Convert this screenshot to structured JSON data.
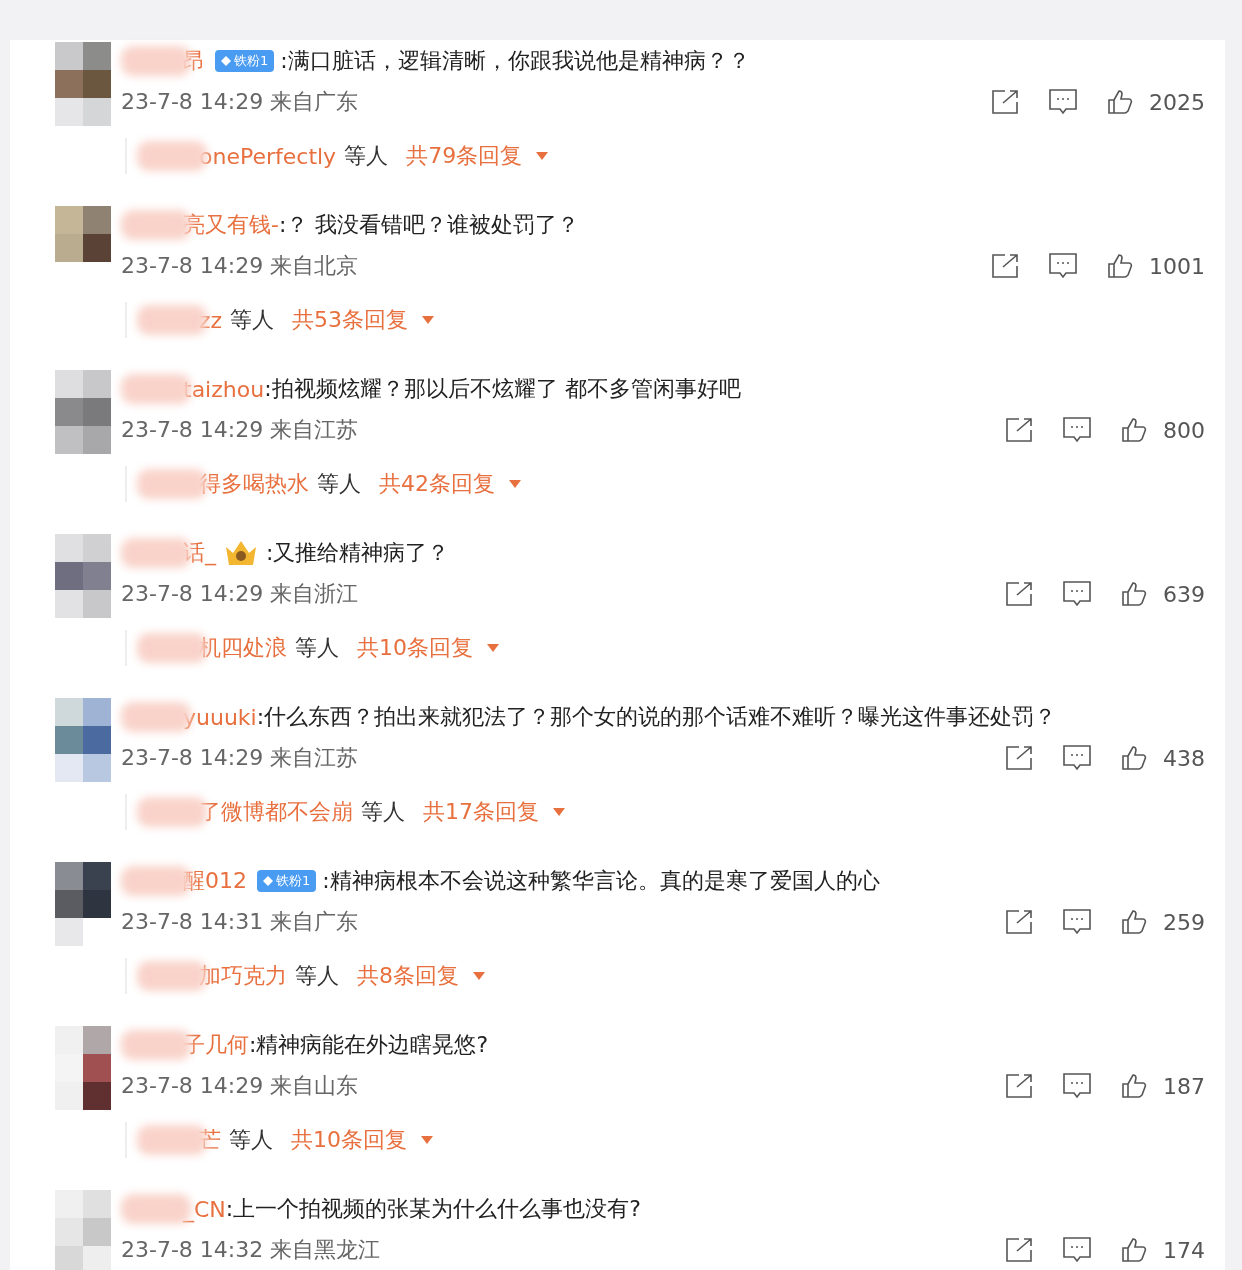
{
  "comments": [
    {
      "name": "昂",
      "badge": {
        "kind": "fan",
        "label": "铁粉1"
      },
      "text": ":满口脏话，逻辑清晰，你跟我说他是精神病？？",
      "time": "23-7-8 14:29",
      "location": "来自广东",
      "likes": "2025",
      "replies": {
        "names": "onePerfectly",
        "others": "等人",
        "count": "共79条回复"
      }
    },
    {
      "name": "亮又有钱-",
      "text": ":？ 我没看错吧？谁被处罚了？",
      "time": "23-7-8 14:29",
      "location": "来自北京",
      "likes": "1001",
      "replies": {
        "names": "zz",
        "others": "等人",
        "count": "共53条回复"
      }
    },
    {
      "name": "taizhou",
      "text": ":拍视频炫耀？那以后不炫耀了 都不多管闲事好吧",
      "time": "23-7-8 14:29",
      "location": "来自江苏",
      "likes": "800",
      "replies": {
        "names": "得多喝热水",
        "others": "等人",
        "count": "共42条回复"
      }
    },
    {
      "name": "话_",
      "badge": {
        "kind": "crown"
      },
      "text": ":又推给精神病了？",
      "time": "23-7-8 14:29",
      "location": "来自浙江",
      "likes": "639",
      "replies": {
        "names": "机四处浪",
        "others": "等人",
        "count": "共10条回复"
      }
    },
    {
      "name": "yuuuki",
      "text": ":什么东西？拍出来就犯法了？那个女的说的那个话难不难听？曝光这件事还处罚？",
      "time": "23-7-8 14:29",
      "location": "来自江苏",
      "likes": "438",
      "replies": {
        "names": "了微博都不会崩",
        "others": "等人",
        "count": "共17条回复"
      }
    },
    {
      "name": "醒012",
      "badge": {
        "kind": "fan",
        "label": "铁粉1"
      },
      "text": ":精神病根本不会说这种繁华言论。真的是寒了爱国人的心",
      "time": "23-7-8 14:31",
      "location": "来自广东",
      "likes": "259",
      "replies": {
        "names": "加巧克力",
        "others": "等人",
        "count": "共8条回复"
      }
    },
    {
      "name": "子几何",
      "text": ":精神病能在外边瞎晃悠?",
      "time": "23-7-8 14:29",
      "location": "来自山东",
      "likes": "187",
      "replies": {
        "names": "芒",
        "others": "等人",
        "count": "共10条回复"
      }
    },
    {
      "name": "_CN",
      "text": ":上一个拍视频的张某为什么什么事也没有?",
      "time": "23-7-8 14:32",
      "location": "来自黑龙江",
      "likes": "174"
    }
  ]
}
